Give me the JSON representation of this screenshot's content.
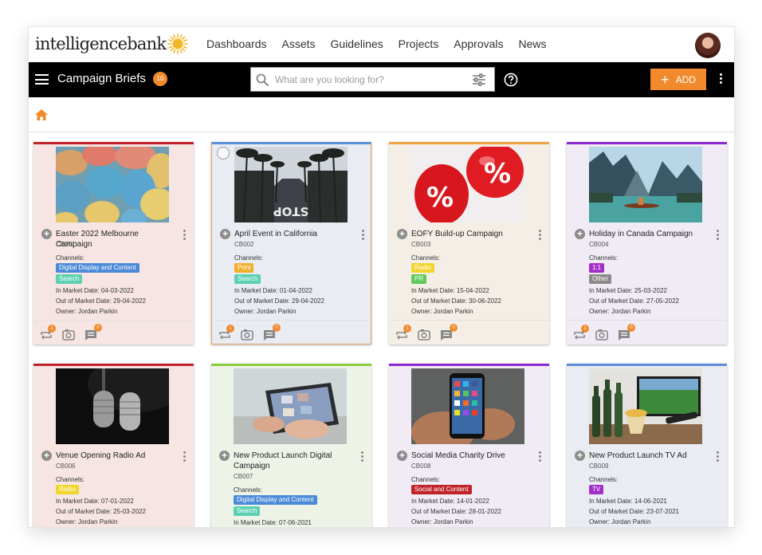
{
  "app": {
    "logo": "intelligencebank"
  },
  "nav": {
    "links": [
      "Dashboards",
      "Assets",
      "Guidelines",
      "Projects",
      "Approvals",
      "News"
    ]
  },
  "header": {
    "title": "Campaign Briefs",
    "count": "10",
    "search_placeholder": "What are you looking for?",
    "add_label": "ADD"
  },
  "colors": {
    "accent": "#f08a2c",
    "header_bg": "#000000"
  },
  "labels": {
    "channels": "Channels:",
    "in_market": "In Market Date:",
    "out_market": "Out of Market Date:",
    "owner": "Owner:"
  },
  "cards": [
    {
      "title": "Easter 2022 Melbourne Campaign",
      "code": "CB001",
      "bg": "#f7e5e3",
      "border": "#c0242a",
      "tags": [
        {
          "label": "Digital Display and Content",
          "color": "#4a8ad8"
        },
        {
          "label": "Search",
          "color": "#5cd1b2"
        }
      ],
      "in_market": "04-03-2022",
      "out_market": "29-04-2022",
      "owner": "Jordan Parkin",
      "badges": {
        "repost": "1",
        "comments": "0"
      },
      "image": "eggs"
    },
    {
      "title": "April Event in California",
      "code": "CB002",
      "bg": "#e9ecf3",
      "border": "#5b8fd6",
      "tags": [
        {
          "label": "Print",
          "color": "#f0b02c"
        },
        {
          "label": "Search",
          "color": "#5cd1b2"
        }
      ],
      "in_market": "01-04-2022",
      "out_market": "29-04-2022",
      "owner": "Jordan Parkin",
      "badges": {
        "repost": "1",
        "comments": "0"
      },
      "image": "street"
    },
    {
      "title": "EOFY Build-up Campaign",
      "code": "CB003",
      "bg": "#f4eee6",
      "border": "#f0a444",
      "tags": [
        {
          "label": "Radio",
          "color": "#f1d52c"
        },
        {
          "label": "PR",
          "color": "#5fc95a"
        }
      ],
      "in_market": "15-04-2022",
      "out_market": "30-06-2022",
      "owner": "Jordan Parkin",
      "badges": {
        "repost": "1",
        "comments": "0"
      },
      "image": "balloons"
    },
    {
      "title": "Holiday in Canada Campaign",
      "code": "CB004",
      "bg": "#f0ebf4",
      "border": "#8a2ad0",
      "tags": [
        {
          "label": "1:1",
          "color": "#a42ec9"
        },
        {
          "label": "Other",
          "color": "#8a8a8a"
        }
      ],
      "in_market": "25-03-2022",
      "out_market": "27-05-2022",
      "owner": "Jordan Parkin",
      "badges": {
        "repost": "1",
        "comments": "0"
      },
      "image": "lake"
    },
    {
      "title": "Venue Opening Radio Ad",
      "code": "CB006",
      "bg": "#f7e5e3",
      "border": "#c0242a",
      "tags": [
        {
          "label": "Radio",
          "color": "#f1d52c"
        }
      ],
      "in_market": "07-01-2022",
      "out_market": "25-03-2022",
      "owner": "Jordan Parkin",
      "badges": {
        "repost": "1",
        "comments": "0"
      },
      "image": "mic"
    },
    {
      "title": "New Product Launch Digital Campaign",
      "code": "CB007",
      "bg": "#eef3e8",
      "border": "#8ccc3c",
      "tags": [
        {
          "label": "Digital Display and Content",
          "color": "#4a8ad8"
        },
        {
          "label": "Search",
          "color": "#5cd1b2"
        }
      ],
      "in_market": "07-06-2021",
      "out_market": "",
      "owner": "",
      "badges": {
        "repost": "1",
        "comments": "0"
      },
      "image": "tablet"
    },
    {
      "title": "Social Media Charity Drive",
      "code": "CB008",
      "bg": "#f0ebf4",
      "border": "#8a2ad0",
      "tags": [
        {
          "label": "Social and Content",
          "color": "#c0242a"
        }
      ],
      "in_market": "14-01-2022",
      "out_market": "28-01-2022",
      "owner": "Jordan Parkin",
      "badges": {
        "repost": "1",
        "comments": "0"
      },
      "image": "phone"
    },
    {
      "title": "New Product Launch TV Ad",
      "code": "CB009",
      "bg": "#e9ecf3",
      "border": "#5b8fd6",
      "tags": [
        {
          "label": "TV",
          "color": "#a42ec9"
        }
      ],
      "in_market": "14-06-2021",
      "out_market": "23-07-2021",
      "owner": "Jordan Parkin",
      "badges": {
        "repost": "1",
        "comments": "0"
      },
      "image": "tv"
    }
  ]
}
